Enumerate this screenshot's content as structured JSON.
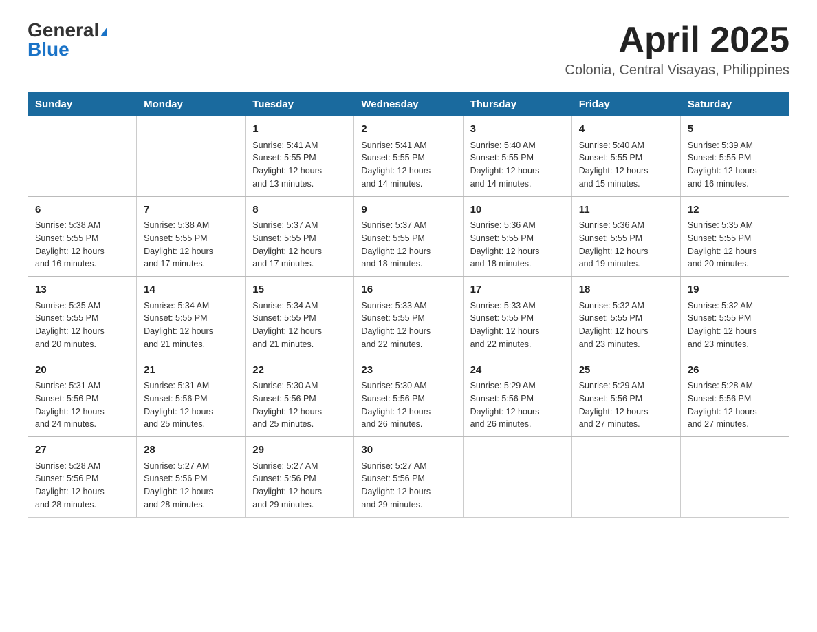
{
  "header": {
    "logo_general": "General",
    "logo_blue": "Blue",
    "month_title": "April 2025",
    "subtitle": "Colonia, Central Visayas, Philippines"
  },
  "days_of_week": [
    "Sunday",
    "Monday",
    "Tuesday",
    "Wednesday",
    "Thursday",
    "Friday",
    "Saturday"
  ],
  "weeks": [
    [
      {
        "day": "",
        "info": ""
      },
      {
        "day": "",
        "info": ""
      },
      {
        "day": "1",
        "info": "Sunrise: 5:41 AM\nSunset: 5:55 PM\nDaylight: 12 hours\nand 13 minutes."
      },
      {
        "day": "2",
        "info": "Sunrise: 5:41 AM\nSunset: 5:55 PM\nDaylight: 12 hours\nand 14 minutes."
      },
      {
        "day": "3",
        "info": "Sunrise: 5:40 AM\nSunset: 5:55 PM\nDaylight: 12 hours\nand 14 minutes."
      },
      {
        "day": "4",
        "info": "Sunrise: 5:40 AM\nSunset: 5:55 PM\nDaylight: 12 hours\nand 15 minutes."
      },
      {
        "day": "5",
        "info": "Sunrise: 5:39 AM\nSunset: 5:55 PM\nDaylight: 12 hours\nand 16 minutes."
      }
    ],
    [
      {
        "day": "6",
        "info": "Sunrise: 5:38 AM\nSunset: 5:55 PM\nDaylight: 12 hours\nand 16 minutes."
      },
      {
        "day": "7",
        "info": "Sunrise: 5:38 AM\nSunset: 5:55 PM\nDaylight: 12 hours\nand 17 minutes."
      },
      {
        "day": "8",
        "info": "Sunrise: 5:37 AM\nSunset: 5:55 PM\nDaylight: 12 hours\nand 17 minutes."
      },
      {
        "day": "9",
        "info": "Sunrise: 5:37 AM\nSunset: 5:55 PM\nDaylight: 12 hours\nand 18 minutes."
      },
      {
        "day": "10",
        "info": "Sunrise: 5:36 AM\nSunset: 5:55 PM\nDaylight: 12 hours\nand 18 minutes."
      },
      {
        "day": "11",
        "info": "Sunrise: 5:36 AM\nSunset: 5:55 PM\nDaylight: 12 hours\nand 19 minutes."
      },
      {
        "day": "12",
        "info": "Sunrise: 5:35 AM\nSunset: 5:55 PM\nDaylight: 12 hours\nand 20 minutes."
      }
    ],
    [
      {
        "day": "13",
        "info": "Sunrise: 5:35 AM\nSunset: 5:55 PM\nDaylight: 12 hours\nand 20 minutes."
      },
      {
        "day": "14",
        "info": "Sunrise: 5:34 AM\nSunset: 5:55 PM\nDaylight: 12 hours\nand 21 minutes."
      },
      {
        "day": "15",
        "info": "Sunrise: 5:34 AM\nSunset: 5:55 PM\nDaylight: 12 hours\nand 21 minutes."
      },
      {
        "day": "16",
        "info": "Sunrise: 5:33 AM\nSunset: 5:55 PM\nDaylight: 12 hours\nand 22 minutes."
      },
      {
        "day": "17",
        "info": "Sunrise: 5:33 AM\nSunset: 5:55 PM\nDaylight: 12 hours\nand 22 minutes."
      },
      {
        "day": "18",
        "info": "Sunrise: 5:32 AM\nSunset: 5:55 PM\nDaylight: 12 hours\nand 23 minutes."
      },
      {
        "day": "19",
        "info": "Sunrise: 5:32 AM\nSunset: 5:55 PM\nDaylight: 12 hours\nand 23 minutes."
      }
    ],
    [
      {
        "day": "20",
        "info": "Sunrise: 5:31 AM\nSunset: 5:56 PM\nDaylight: 12 hours\nand 24 minutes."
      },
      {
        "day": "21",
        "info": "Sunrise: 5:31 AM\nSunset: 5:56 PM\nDaylight: 12 hours\nand 25 minutes."
      },
      {
        "day": "22",
        "info": "Sunrise: 5:30 AM\nSunset: 5:56 PM\nDaylight: 12 hours\nand 25 minutes."
      },
      {
        "day": "23",
        "info": "Sunrise: 5:30 AM\nSunset: 5:56 PM\nDaylight: 12 hours\nand 26 minutes."
      },
      {
        "day": "24",
        "info": "Sunrise: 5:29 AM\nSunset: 5:56 PM\nDaylight: 12 hours\nand 26 minutes."
      },
      {
        "day": "25",
        "info": "Sunrise: 5:29 AM\nSunset: 5:56 PM\nDaylight: 12 hours\nand 27 minutes."
      },
      {
        "day": "26",
        "info": "Sunrise: 5:28 AM\nSunset: 5:56 PM\nDaylight: 12 hours\nand 27 minutes."
      }
    ],
    [
      {
        "day": "27",
        "info": "Sunrise: 5:28 AM\nSunset: 5:56 PM\nDaylight: 12 hours\nand 28 minutes."
      },
      {
        "day": "28",
        "info": "Sunrise: 5:27 AM\nSunset: 5:56 PM\nDaylight: 12 hours\nand 28 minutes."
      },
      {
        "day": "29",
        "info": "Sunrise: 5:27 AM\nSunset: 5:56 PM\nDaylight: 12 hours\nand 29 minutes."
      },
      {
        "day": "30",
        "info": "Sunrise: 5:27 AM\nSunset: 5:56 PM\nDaylight: 12 hours\nand 29 minutes."
      },
      {
        "day": "",
        "info": ""
      },
      {
        "day": "",
        "info": ""
      },
      {
        "day": "",
        "info": ""
      }
    ]
  ]
}
